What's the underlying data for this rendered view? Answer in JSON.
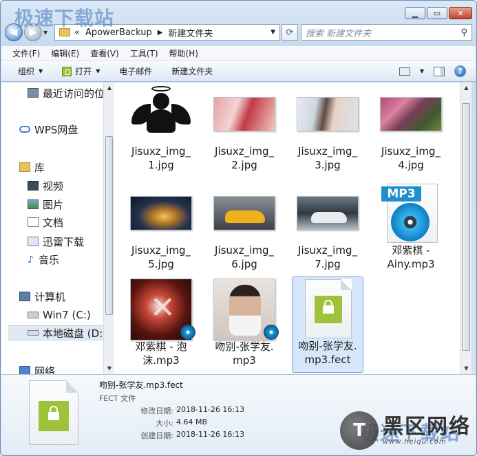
{
  "watermark_top": "极速下载站",
  "address": {
    "prefix": "«",
    "crumbs": [
      "ApowerBackup",
      "新建文件夹"
    ]
  },
  "search": {
    "placeholder": "搜索 新建文件夹"
  },
  "menu": [
    "文件(F)",
    "编辑(E)",
    "查看(V)",
    "工具(T)",
    "帮助(H)"
  ],
  "toolbar": {
    "organize": "组织",
    "open": "打开",
    "email": "电子邮件",
    "new_folder": "新建文件夹"
  },
  "nav": {
    "recent": "最近访问的位",
    "wps": "WPS网盘",
    "library": "库",
    "video": "视频",
    "pictures": "图片",
    "documents": "文档",
    "xunlei": "迅雷下载",
    "music": "音乐",
    "computer": "计算机",
    "win7": "Win7 (C:)",
    "localdisk": "本地磁盘 (D:",
    "network": "网络"
  },
  "files": [
    {
      "line1": "Jisuxz_img_",
      "line2": "1.jpg"
    },
    {
      "line1": "Jisuxz_img_",
      "line2": "2.jpg"
    },
    {
      "line1": "Jisuxz_img_",
      "line2": "3.jpg"
    },
    {
      "line1": "Jisuxz_img_",
      "line2": "4.jpg"
    },
    {
      "line1": "Jisuxz_img_",
      "line2": "5.jpg"
    },
    {
      "line1": "Jisuxz_img_",
      "line2": "6.jpg"
    },
    {
      "line1": "Jisuxz_img_",
      "line2": "7.jpg"
    },
    {
      "line1": "邓紫棋 -",
      "line2": "Ainy.mp3",
      "badge": "MP3"
    },
    {
      "line1": "邓紫棋 - 泡",
      "line2": "沫.mp3"
    },
    {
      "line1": "吻别-张学友.",
      "line2": "mp3"
    },
    {
      "line1": "吻别-张学友.",
      "line2": "mp3.fect"
    }
  ],
  "details": {
    "filename": "吻别-张学友.mp3.fect",
    "filetype": "FECT 文件",
    "modified_label": "修改日期:",
    "modified": "2018-11-26 16:13",
    "size_label": "大小:",
    "size": "4.64 MB",
    "created_label": "创建日期:",
    "created": "2018-11-26 16:13"
  },
  "watermark_br": {
    "brand": "黑区网络",
    "url": "www.heiqu.com",
    "brand2": "极速下载站"
  }
}
